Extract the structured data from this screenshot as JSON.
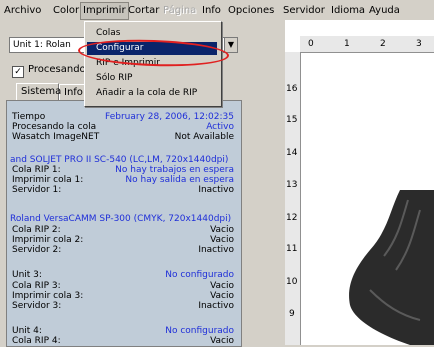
{
  "menubar": [
    "Archivo",
    "Color",
    "Imprimir",
    "Cortar",
    "Página",
    "Info",
    "Opciones",
    "Servidor",
    "Idioma",
    "Ayuda"
  ],
  "unit_select": {
    "value": "Unit 1: Rolan"
  },
  "processing": {
    "checkbox_label": "Procesando",
    "checked": true
  },
  "tabs": [
    "Sistema",
    "Info"
  ],
  "status": {
    "tiempo_label": "Tiempo",
    "tiempo_value": "February 28, 2006,  12:02:35",
    "cola_label": "Procesando la cola",
    "cola_value": "Activo",
    "wasatch_label": "Wasatch ImageNET",
    "wasatch_value": "Not Available"
  },
  "printers": [
    {
      "name": "and  SOLJET PRO II SC-540 (LC,LM, 720x1440dpi)",
      "rows": [
        {
          "label": "Cola RIP 1:",
          "value": "No hay trabajos en espera"
        },
        {
          "label": "Imprimir cola 1:",
          "value": "No hay salida en espera"
        },
        {
          "label": "Servidor 1:",
          "value": "Inactivo"
        }
      ]
    },
    {
      "name": "Roland  VersaCAMM SP-300 (CMYK, 720x1440dpi)",
      "rows": [
        {
          "label": "Cola RIP  2:",
          "value": "Vacio"
        },
        {
          "label": "Imprimir cola 2:",
          "value": "Vacio"
        },
        {
          "label": "Servidor 2:",
          "value": "Inactivo"
        }
      ]
    },
    {
      "name": "Unit 3:",
      "status": "No configurado",
      "rows": [
        {
          "label": "Cola RIP  3:",
          "value": "Vacio"
        },
        {
          "label": "Imprimir cola 3:",
          "value": "Vacio"
        },
        {
          "label": "Servidor 3:",
          "value": "Inactivo"
        }
      ]
    },
    {
      "name": "Unit 4:",
      "status": "No configurado",
      "rows": [
        {
          "label": "Cola RIP  4:",
          "value": "Vacio"
        }
      ]
    }
  ],
  "dropdown": {
    "items": [
      "Colas",
      "Configurar",
      "RIP e Imprimir",
      "Sólo RIP",
      "Añadir a la cola de RIP"
    ],
    "selected_index": 1
  },
  "ruler": {
    "horizontal": [
      "0",
      "1",
      "2",
      "3"
    ],
    "vertical": [
      "16",
      "15",
      "14",
      "13",
      "12",
      "11",
      "10",
      "9"
    ]
  },
  "colors": {
    "accent": "#0a246a",
    "link_blue": "#1f2fd8",
    "highlight": "#e02020"
  }
}
